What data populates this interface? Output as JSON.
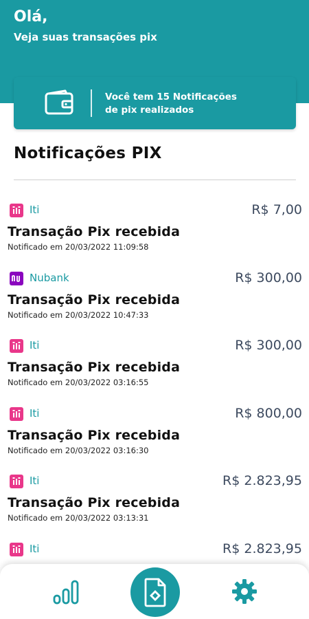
{
  "header": {
    "greeting": "Olá,",
    "subtitle": "Veja suas transações pix"
  },
  "summary_card": {
    "line1": "Você tem 15 Notificações",
    "line2": "de pix realizados",
    "icon": "wallet-icon"
  },
  "section": {
    "title": "Notificações PIX"
  },
  "transactions": [
    {
      "bank": "Iti",
      "logo": "iti-logo",
      "amount": "R$ 7,00",
      "title": "Transação Pix recebida",
      "date": "Notificado em 20/03/2022 11:09:58"
    },
    {
      "bank": "Nubank",
      "logo": "nubank-logo",
      "amount": "R$ 300,00",
      "title": "Transação Pix recebida",
      "date": "Notificado em 20/03/2022 10:47:33"
    },
    {
      "bank": "Iti",
      "logo": "iti-logo",
      "amount": "R$ 300,00",
      "title": "Transação Pix recebida",
      "date": "Notificado em 20/03/2022 03:16:55"
    },
    {
      "bank": "Iti",
      "logo": "iti-logo",
      "amount": "R$ 800,00",
      "title": "Transação Pix recebida",
      "date": "Notificado em 20/03/2022 03:16:30"
    },
    {
      "bank": "Iti",
      "logo": "iti-logo",
      "amount": "R$ 2.823,95",
      "title": "Transação Pix recebida",
      "date": "Notificado em 20/03/2022 03:13:31"
    },
    {
      "bank": "Iti",
      "logo": "iti-logo",
      "amount": "R$ 2.823,95",
      "title": "",
      "date": ""
    }
  ],
  "bottom_nav": {
    "items": [
      "bar-chart-icon",
      "pix-document-icon",
      "gear-icon"
    ]
  },
  "colors": {
    "primary": "#1a9aa2",
    "iti": "#e9378a",
    "nubank": "#8a05be",
    "amount": "#3d4a5f"
  }
}
